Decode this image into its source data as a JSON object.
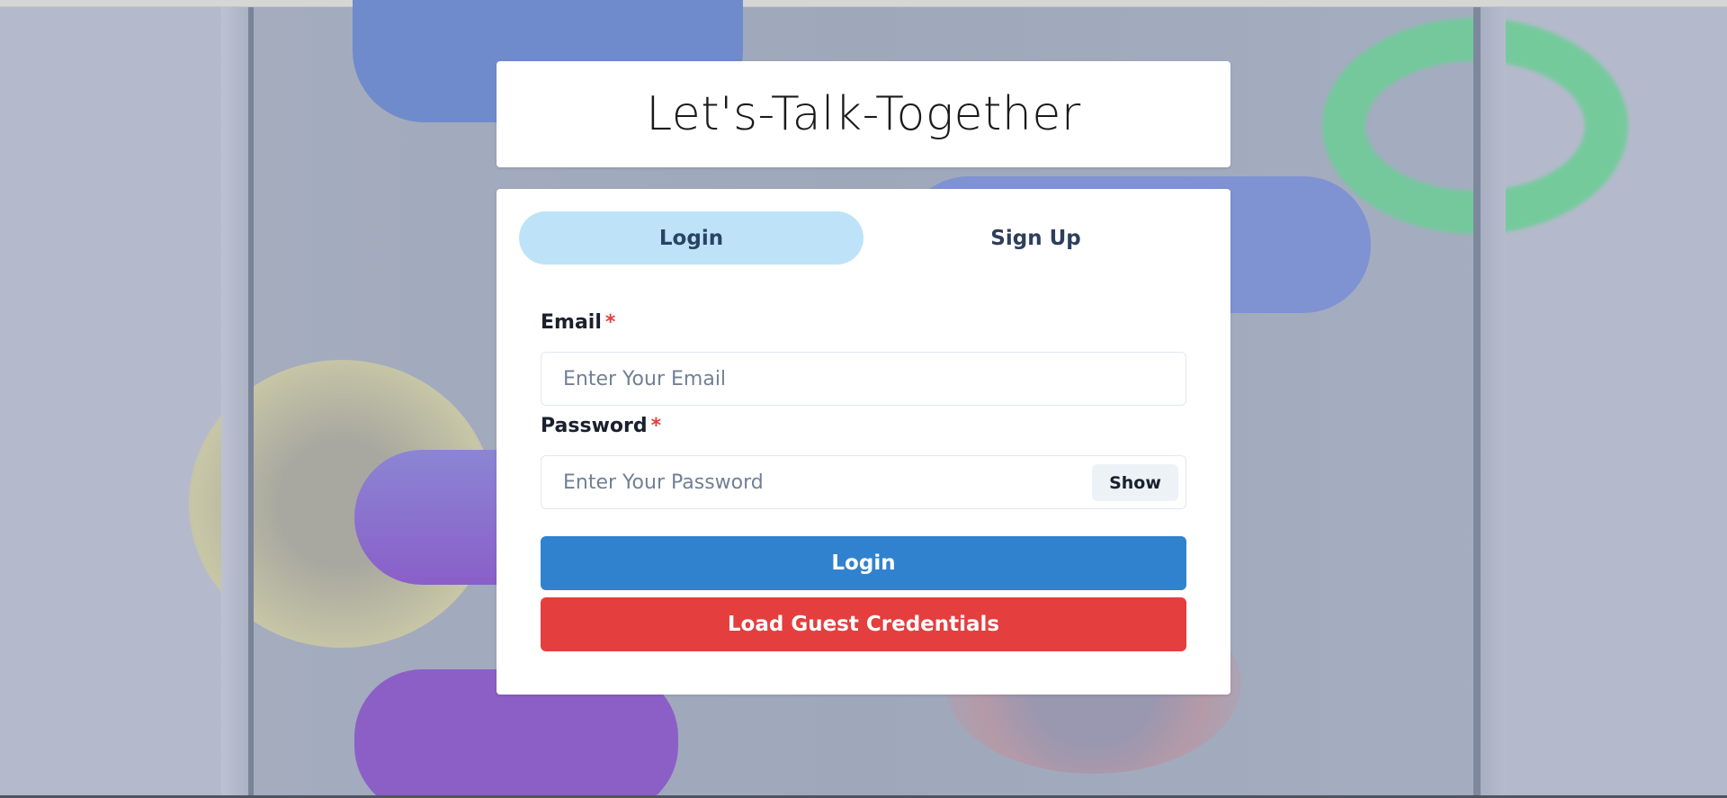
{
  "app": {
    "title": "Let's-Talk-Together"
  },
  "tabs": [
    {
      "label": "Login",
      "active": true
    },
    {
      "label": "Sign Up",
      "active": false
    }
  ],
  "form": {
    "email": {
      "label": "Email",
      "required_mark": "*",
      "placeholder": "Enter Your Email",
      "value": ""
    },
    "password": {
      "label": "Password",
      "required_mark": "*",
      "placeholder": "Enter Your Password",
      "value": "",
      "toggle_label": "Show"
    },
    "login_button": "Login",
    "guest_button": "Load Guest Credentials"
  },
  "colors": {
    "tab_active_bg": "#bee3f8",
    "login_button": "#3182ce",
    "guest_button": "#e53e3e",
    "required_mark": "#e53e3e"
  }
}
